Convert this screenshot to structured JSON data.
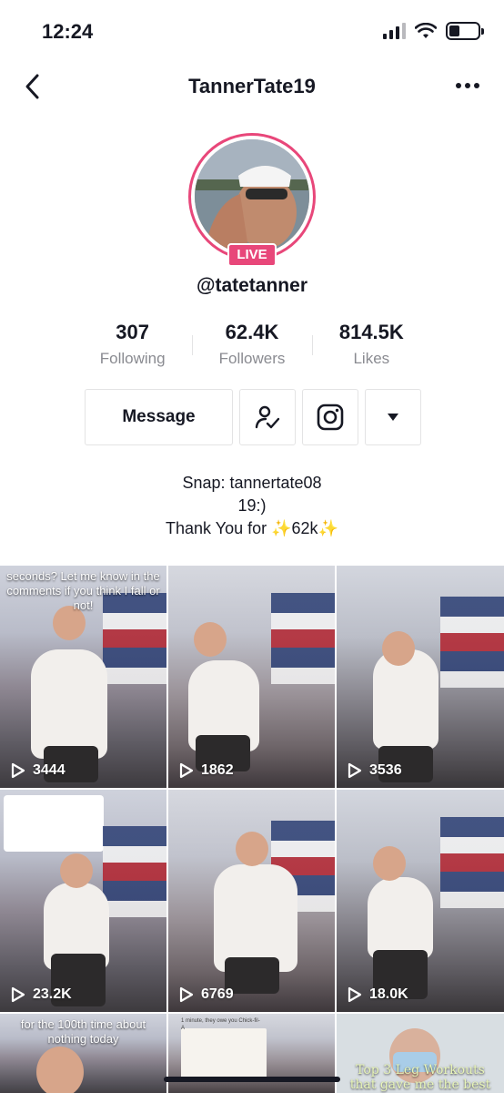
{
  "status_bar": {
    "time": "12:24"
  },
  "nav": {
    "title": "TannerTate19"
  },
  "profile": {
    "live_label": "LIVE",
    "username": "@tatetanner",
    "stats": [
      {
        "value": "307",
        "label": "Following"
      },
      {
        "value": "62.4K",
        "label": "Followers"
      },
      {
        "value": "814.5K",
        "label": "Likes"
      }
    ],
    "message_label": "Message",
    "bio_lines": [
      "Snap: tannertate08",
      "19:)",
      "Thank You for ✨62k✨"
    ]
  },
  "videos": [
    {
      "views": "3444",
      "caption": "seconds? Let me know in the comments if you think I fall or not!"
    },
    {
      "views": "1862"
    },
    {
      "views": "3536"
    },
    {
      "views": "23.2K"
    },
    {
      "views": "6769"
    },
    {
      "views": "18.0K"
    },
    {
      "caption": "for the 100th time about nothing today"
    },
    {
      "caption": "1 minute, they owe you Chick-fil-A"
    },
    {
      "caption": "Top 3 Leg Workouts that gave me the best"
    }
  ],
  "colors": {
    "accent": "#e8477a",
    "text": "#161823",
    "muted": "#8a8b91",
    "border": "#e3e3e4"
  }
}
